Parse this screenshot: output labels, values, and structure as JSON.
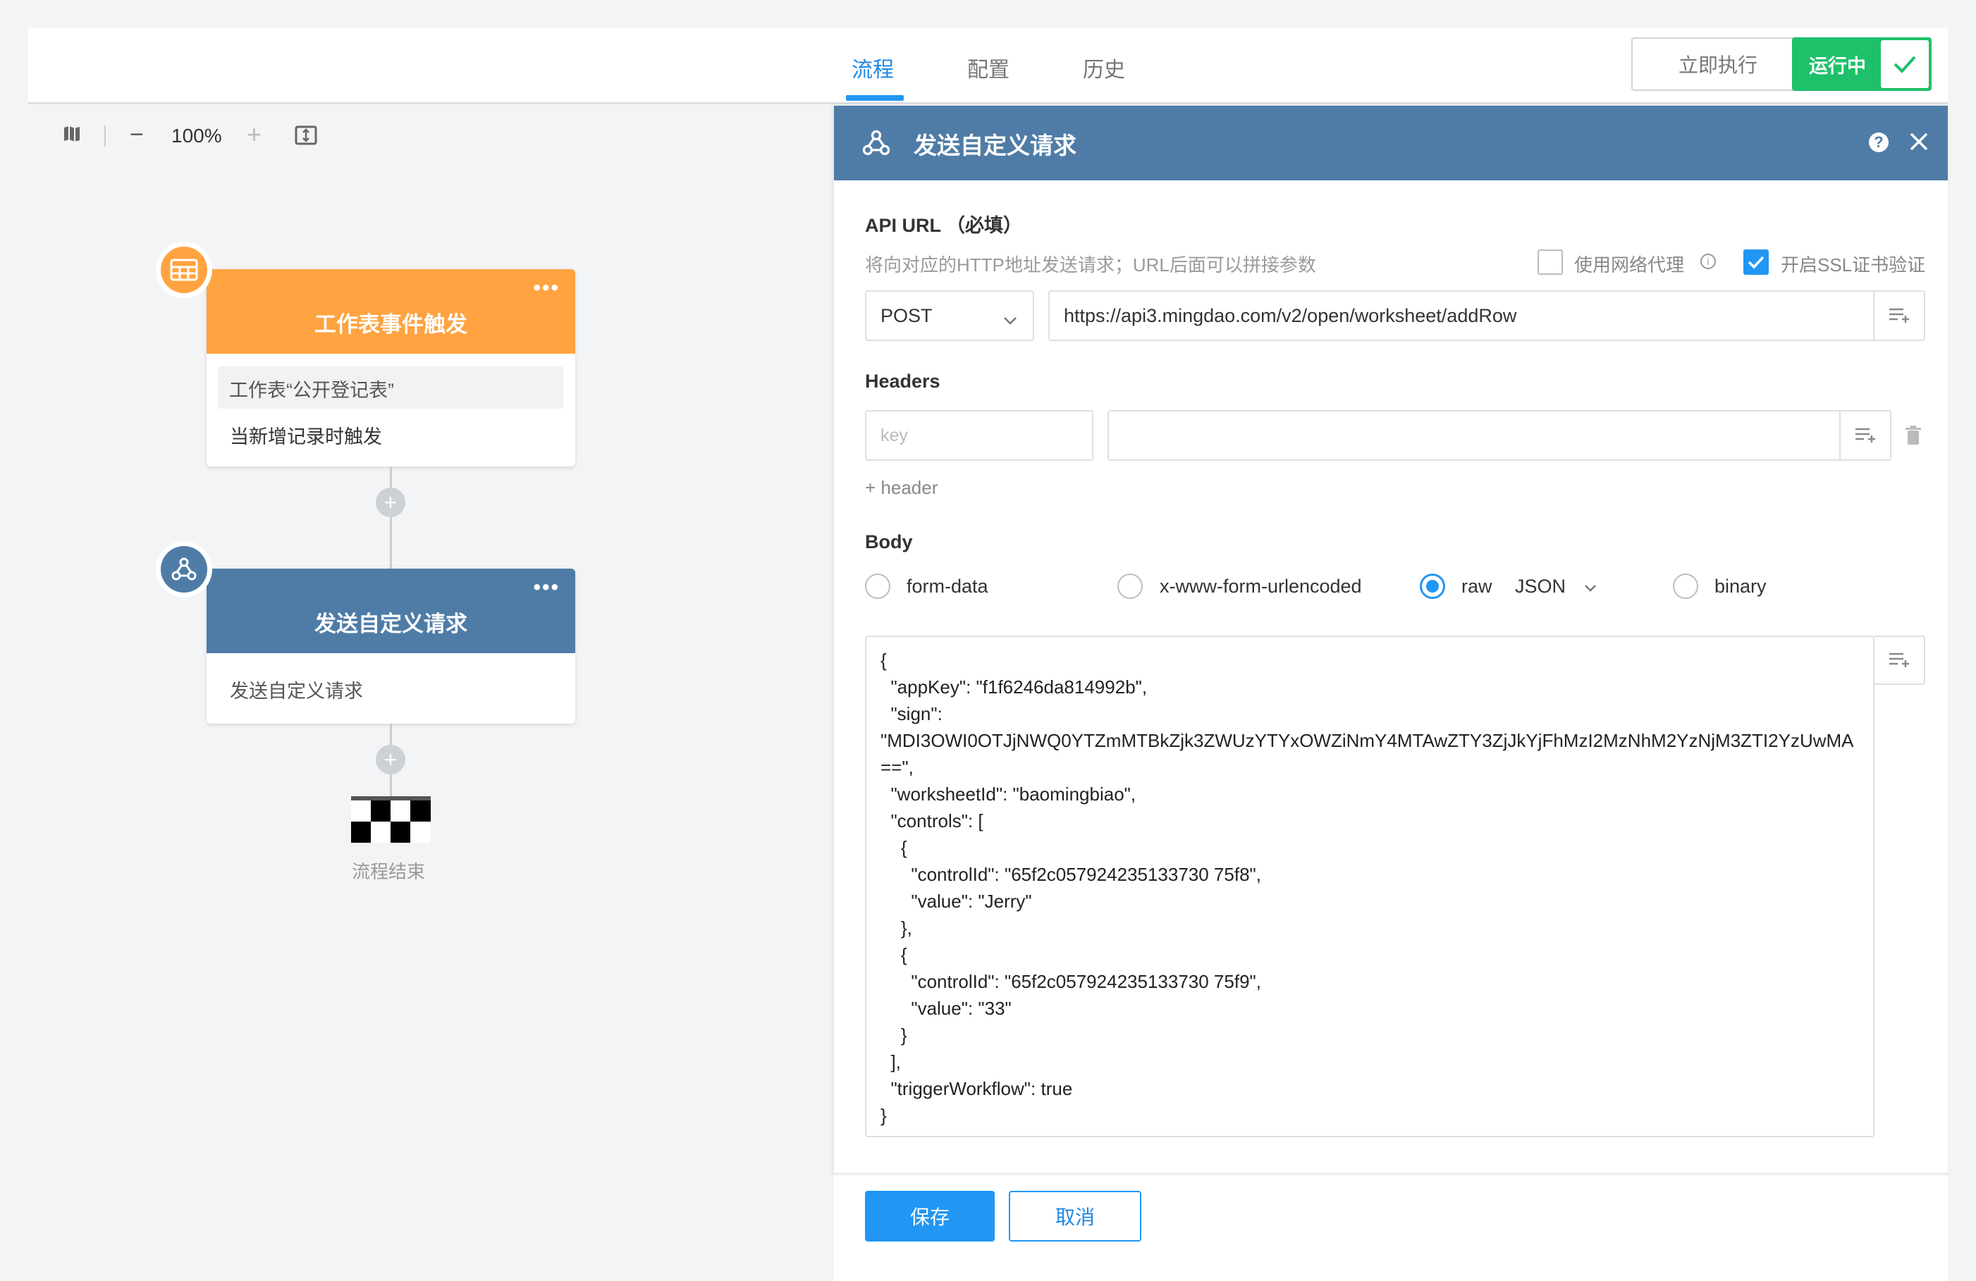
{
  "tabs": [
    {
      "label": "流程"
    },
    {
      "label": "配置"
    },
    {
      "label": "历史"
    }
  ],
  "header": {
    "run_now_label": "立即执行",
    "status_label": "运行中"
  },
  "canvas": {
    "zoom": "100%"
  },
  "nodes": {
    "trigger": {
      "title": "工作表事件触发",
      "line1": "工作表“公开登记表”",
      "line2": "当新增记录时触发",
      "color": "#ffa340"
    },
    "request": {
      "title": "发送自定义请求",
      "line1": "发送自定义请求",
      "color": "#4f7ca6"
    },
    "end": {
      "label": "流程结束"
    }
  },
  "panel": {
    "title": "发送自定义请求",
    "api_url_label": "API URL （必填）",
    "api_url_hint": "将向对应的HTTP地址发送请求；URL后面可以拼接参数",
    "proxy_label": "使用网络代理",
    "ssl_label": "开启SSL证书验证",
    "method": "POST",
    "url": "https://api3.mingdao.com/v2/open/worksheet/addRow",
    "headers_label": "Headers",
    "header_key_placeholder": "key",
    "add_header_label": "+ header",
    "body_label": "Body",
    "body_options": {
      "form_data": "form-data",
      "urlencoded": "x-www-form-urlencoded",
      "raw": "raw",
      "raw_type": "JSON",
      "binary": "binary"
    },
    "body_text": "{\n  \"appKey\": \"f1f6246da814992b\",\n  \"sign\":\n\"MDI3OWI0OTJjNWQ0YTZmMTBkZjk3ZWUzYTYxOWZiNmY4MTAwZTY3ZjJkYjFhMzI2MzNhM2YzNjM3ZTI2YzUwMA\n==\",\n  \"worksheetId\": \"baomingbiao\",\n  \"controls\": [\n    {\n      \"controlId\": \"65f2c057924235133730 75f8\",\n      \"value\": \"Jerry\"\n    },\n    {\n      \"controlId\": \"65f2c057924235133730 75f9\",\n      \"value\": \"33\"\n    }\n  ],\n  \"triggerWorkflow\": true\n}",
    "save_label": "保存",
    "cancel_label": "取消"
  }
}
